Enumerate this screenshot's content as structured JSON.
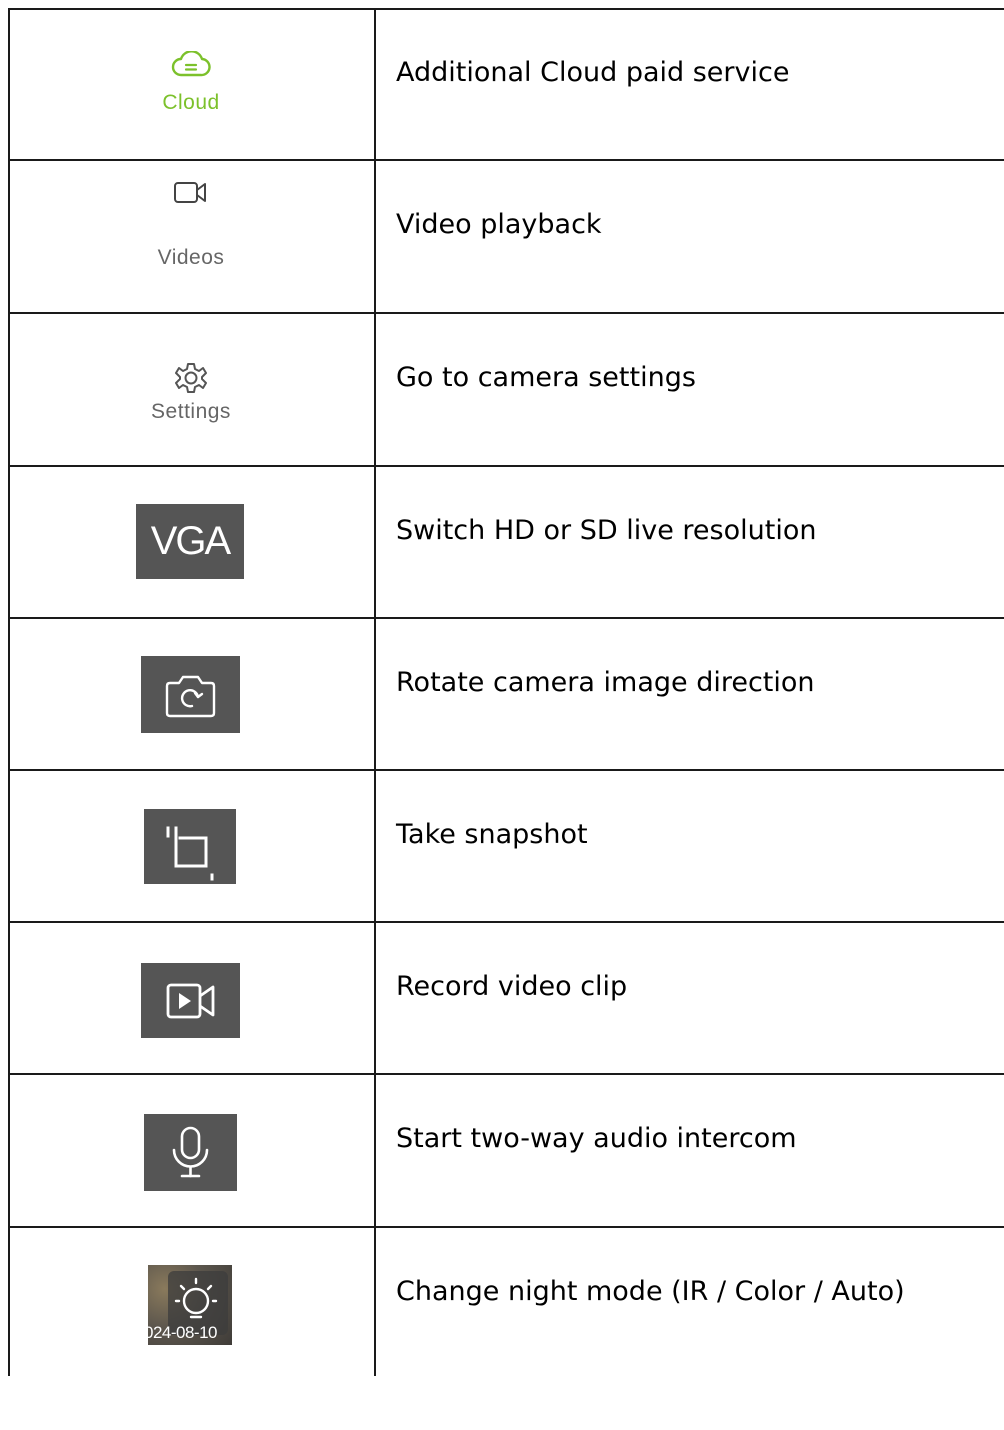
{
  "rows": [
    {
      "icon_name": "cloud-icon",
      "icon_label": "Cloud",
      "icon_color": "#7cc12b",
      "description": "Additional Cloud paid service"
    },
    {
      "icon_name": "video-camera-icon",
      "icon_label": "Videos",
      "icon_color": "#666666",
      "description": "Video playback"
    },
    {
      "icon_name": "gear-icon",
      "icon_label": "Settings",
      "icon_color": "#666666",
      "description": "Go to camera settings"
    },
    {
      "icon_name": "resolution-button",
      "icon_label": "VGA",
      "icon_color": "#555555",
      "description": "Switch HD or SD live resolution"
    },
    {
      "icon_name": "rotate-camera-icon",
      "icon_color": "#555555",
      "description": "Rotate camera image direction"
    },
    {
      "icon_name": "crop-snapshot-icon",
      "icon_color": "#555555",
      "description": "Take snapshot"
    },
    {
      "icon_name": "record-video-icon",
      "icon_color": "#555555",
      "description": "Record video clip"
    },
    {
      "icon_name": "microphone-icon",
      "icon_color": "#555555",
      "description": "Start two-way audio intercom"
    },
    {
      "icon_name": "light-bulb-icon",
      "icon_overlay_text": "024-08-10",
      "description": "Change night mode (IR / Color / Auto)"
    }
  ]
}
